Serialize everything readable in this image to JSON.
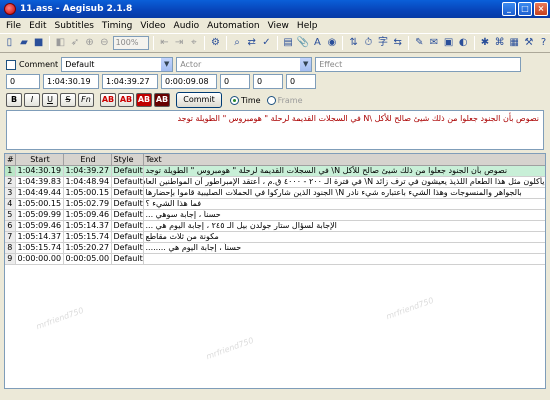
{
  "window": {
    "title": "11.ass - Aegisub 2.1.8"
  },
  "menu": [
    "File",
    "Edit",
    "Subtitles",
    "Timing",
    "Video",
    "Audio",
    "Automation",
    "View",
    "Help"
  ],
  "toolbar": {
    "zoom": "100%"
  },
  "edit": {
    "comment_label": "Comment",
    "style": "Default",
    "actor_placeholder": "Actor",
    "effect_placeholder": "Effect",
    "layer": "0",
    "start": "1:04:30.19",
    "end": "1:04:39.27",
    "duration": "0:00:09.08",
    "margin_l": "0",
    "margin_r": "0",
    "margin_v": "0",
    "buttons": {
      "bold": "B",
      "italic": "I",
      "underline": "U",
      "strike": "S",
      "font": "Fn",
      "ab1": "AB",
      "ab2": "AB",
      "ab3": "AB",
      "ab4": "AB",
      "commit": "Commit"
    },
    "time_label": "Time",
    "frame_label": "Frame",
    "text_line1": "نصوص بأن الجنود جعلوا من ذلك شيئ صالح للأكل \\N في السجلات القديمة لرحلة \" هومبروس \" الطويلة توجد"
  },
  "grid": {
    "headers": [
      "#",
      "Start",
      "End",
      "Style",
      "Text"
    ],
    "rows": [
      {
        "n": "1",
        "start": "1:04:30.19",
        "end": "1:04:39.27",
        "style": "Default",
        "text": "نصوص بأن الجنود جعلوا من ذلك شيئ صالح للأكل N\\ في السجلات القديمة لرحلة \" هومبروس \" الطويلة توجد"
      },
      {
        "n": "2",
        "start": "1:04:39.83",
        "end": "1:04:48.94",
        "style": "Default",
        "text": "يأكلون مثل هذا الطعام اللذيذ يعيشون في ترف زائد N\\ في فترة الـ ٢٠٠ - ٤٠٠٠ ق.م ، أعتقد الإمبراطور أن المواطنين العاديين"
      },
      {
        "n": "3",
        "start": "1:04:49.44",
        "end": "1:05:00.15",
        "style": "Default",
        "text": "بالجواهر والمنسوجات وهذا الشيء باعتباره شيء نادر N\\ الجنود الذين شاركوا في الحملات الصليبية قاموا بإحضارها"
      },
      {
        "n": "4",
        "start": "1:05:00.15",
        "end": "1:05:02.79",
        "style": "Default",
        "text": "فما هذا الشيء ؟"
      },
      {
        "n": "5",
        "start": "1:05:09.99",
        "end": "1:05:09.46",
        "style": "Default",
        "text": "حسناً ، إجابة سوهي ..."
      },
      {
        "n": "6",
        "start": "1:05:09.46",
        "end": "1:05:14.37",
        "style": "Default",
        "text": "الإجابة لسؤال ستار جولدن بيل الـ ٢٤٥ ، إجابة اليوم هي ..."
      },
      {
        "n": "7",
        "start": "1:05:14.37",
        "end": "1:05:15.74",
        "style": "Default",
        "text": "مكونة من ثلاث مقاطع"
      },
      {
        "n": "8",
        "start": "1:05:15.74",
        "end": "1:05:20.27",
        "style": "Default",
        "text": "حسناً ، إجابة اليوم هي ........"
      },
      {
        "n": "9",
        "start": "0:00:00.00",
        "end": "0:00:05.00",
        "style": "Default",
        "text": ""
      }
    ],
    "active_row": 0
  },
  "watermark": "mrfriend750"
}
